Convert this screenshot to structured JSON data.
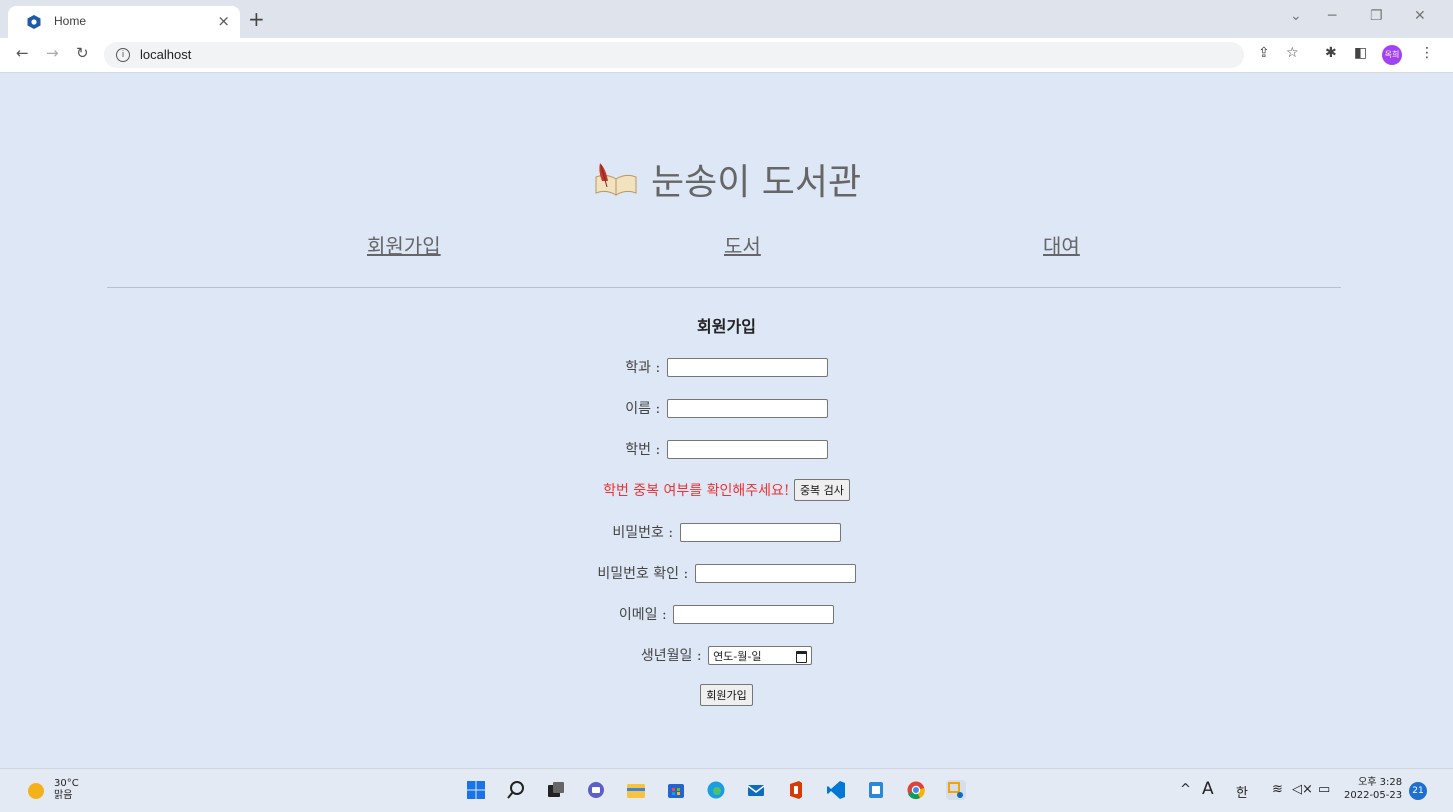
{
  "browser": {
    "tab_title": "Home",
    "tab_close": "×",
    "new_tab": "+",
    "url": "localhost",
    "profile_label": "옥희",
    "window_controls": {
      "minimize": "─",
      "restore": "❐",
      "close": "✕",
      "tab_list": "⌄"
    }
  },
  "header": {
    "title": "눈송이 도서관",
    "nav": [
      {
        "label": "회원가입"
      },
      {
        "label": "도서"
      },
      {
        "label": "대여"
      }
    ]
  },
  "form": {
    "title": "회원가입",
    "fields": {
      "department": {
        "label": "학과 :",
        "value": ""
      },
      "name": {
        "label": "이름 :",
        "value": ""
      },
      "student_id": {
        "label": "학번 :",
        "value": ""
      },
      "password": {
        "label": "비밀번호 :",
        "value": ""
      },
      "password_confirm": {
        "label": "비밀번호 확인 :",
        "value": ""
      },
      "email": {
        "label": "이메일 :",
        "value": ""
      },
      "birthdate": {
        "label": "생년월일 :",
        "placeholder": "연도-월-일"
      }
    },
    "duplicate_warning": "학번 중복 여부를 확인해주세요!",
    "duplicate_check_label": "중복 검사",
    "submit_label": "회원가입"
  },
  "taskbar": {
    "temperature": "30°C",
    "weather": "맑음",
    "ime_a": "A",
    "ime_lang": "한",
    "time": "오후 3:28",
    "date": "2022-05-23",
    "notification_count": "21"
  }
}
